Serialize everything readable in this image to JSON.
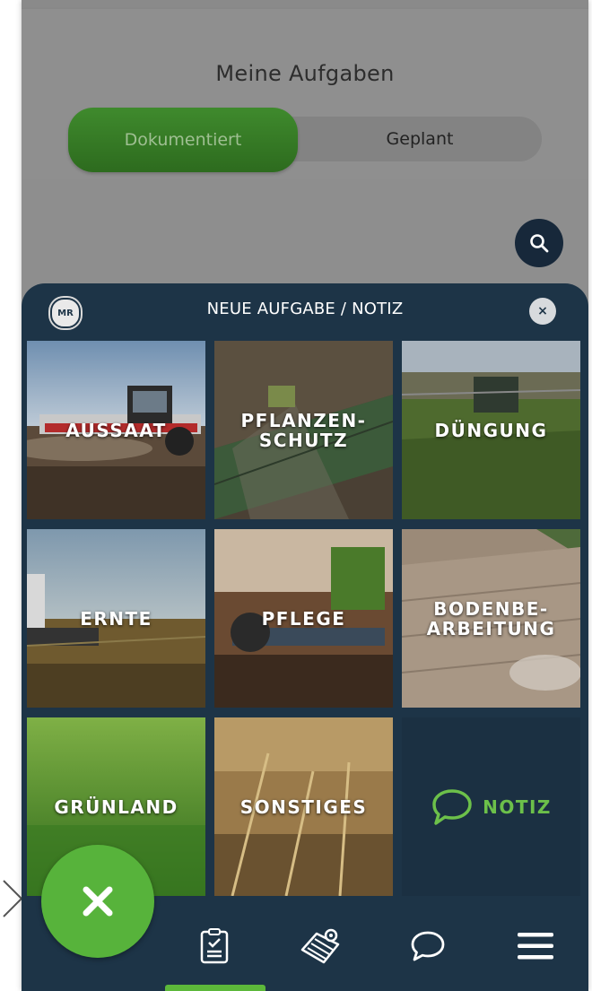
{
  "header": {
    "title": "Meine Aufgaben",
    "tabs": [
      {
        "label": "Dokumentiert",
        "active": true
      },
      {
        "label": "Geplant",
        "active": false
      }
    ]
  },
  "search": {
    "icon": "search-icon"
  },
  "sheet": {
    "logo_text": "MR",
    "title": "NEUE AUFGABE / NOTIZ",
    "close_label": "×",
    "tiles": [
      {
        "label": "AUSSAAT"
      },
      {
        "label": "PFLANZEN-SCHUTZ",
        "line1": "PFLANZEN-",
        "line2": "SCHUTZ"
      },
      {
        "label": "DÜNGUNG"
      },
      {
        "label": "ERNTE"
      },
      {
        "label": "PFLEGE"
      },
      {
        "label": "BODENBE-ARBEITUNG",
        "line1": "BODENBE-",
        "line2": "ARBEITUNG"
      },
      {
        "label": "GRÜNLAND"
      },
      {
        "label": "SONSTIGES"
      },
      {
        "label": "NOTIZ",
        "icon": "speech-bubble-icon"
      }
    ]
  },
  "bottom_nav": {
    "items": [
      {
        "icon": "clipboard-checklist-icon",
        "active": true
      },
      {
        "icon": "field-map-icon",
        "active": false
      },
      {
        "icon": "chat-bubble-icon",
        "active": false
      },
      {
        "icon": "hamburger-menu-icon",
        "active": false
      }
    ]
  },
  "fab": {
    "icon": "close-x-icon"
  },
  "colors": {
    "accent_green": "#57b33b",
    "navy": "#1d3447",
    "overlay_gray": "#8e8e8e"
  }
}
